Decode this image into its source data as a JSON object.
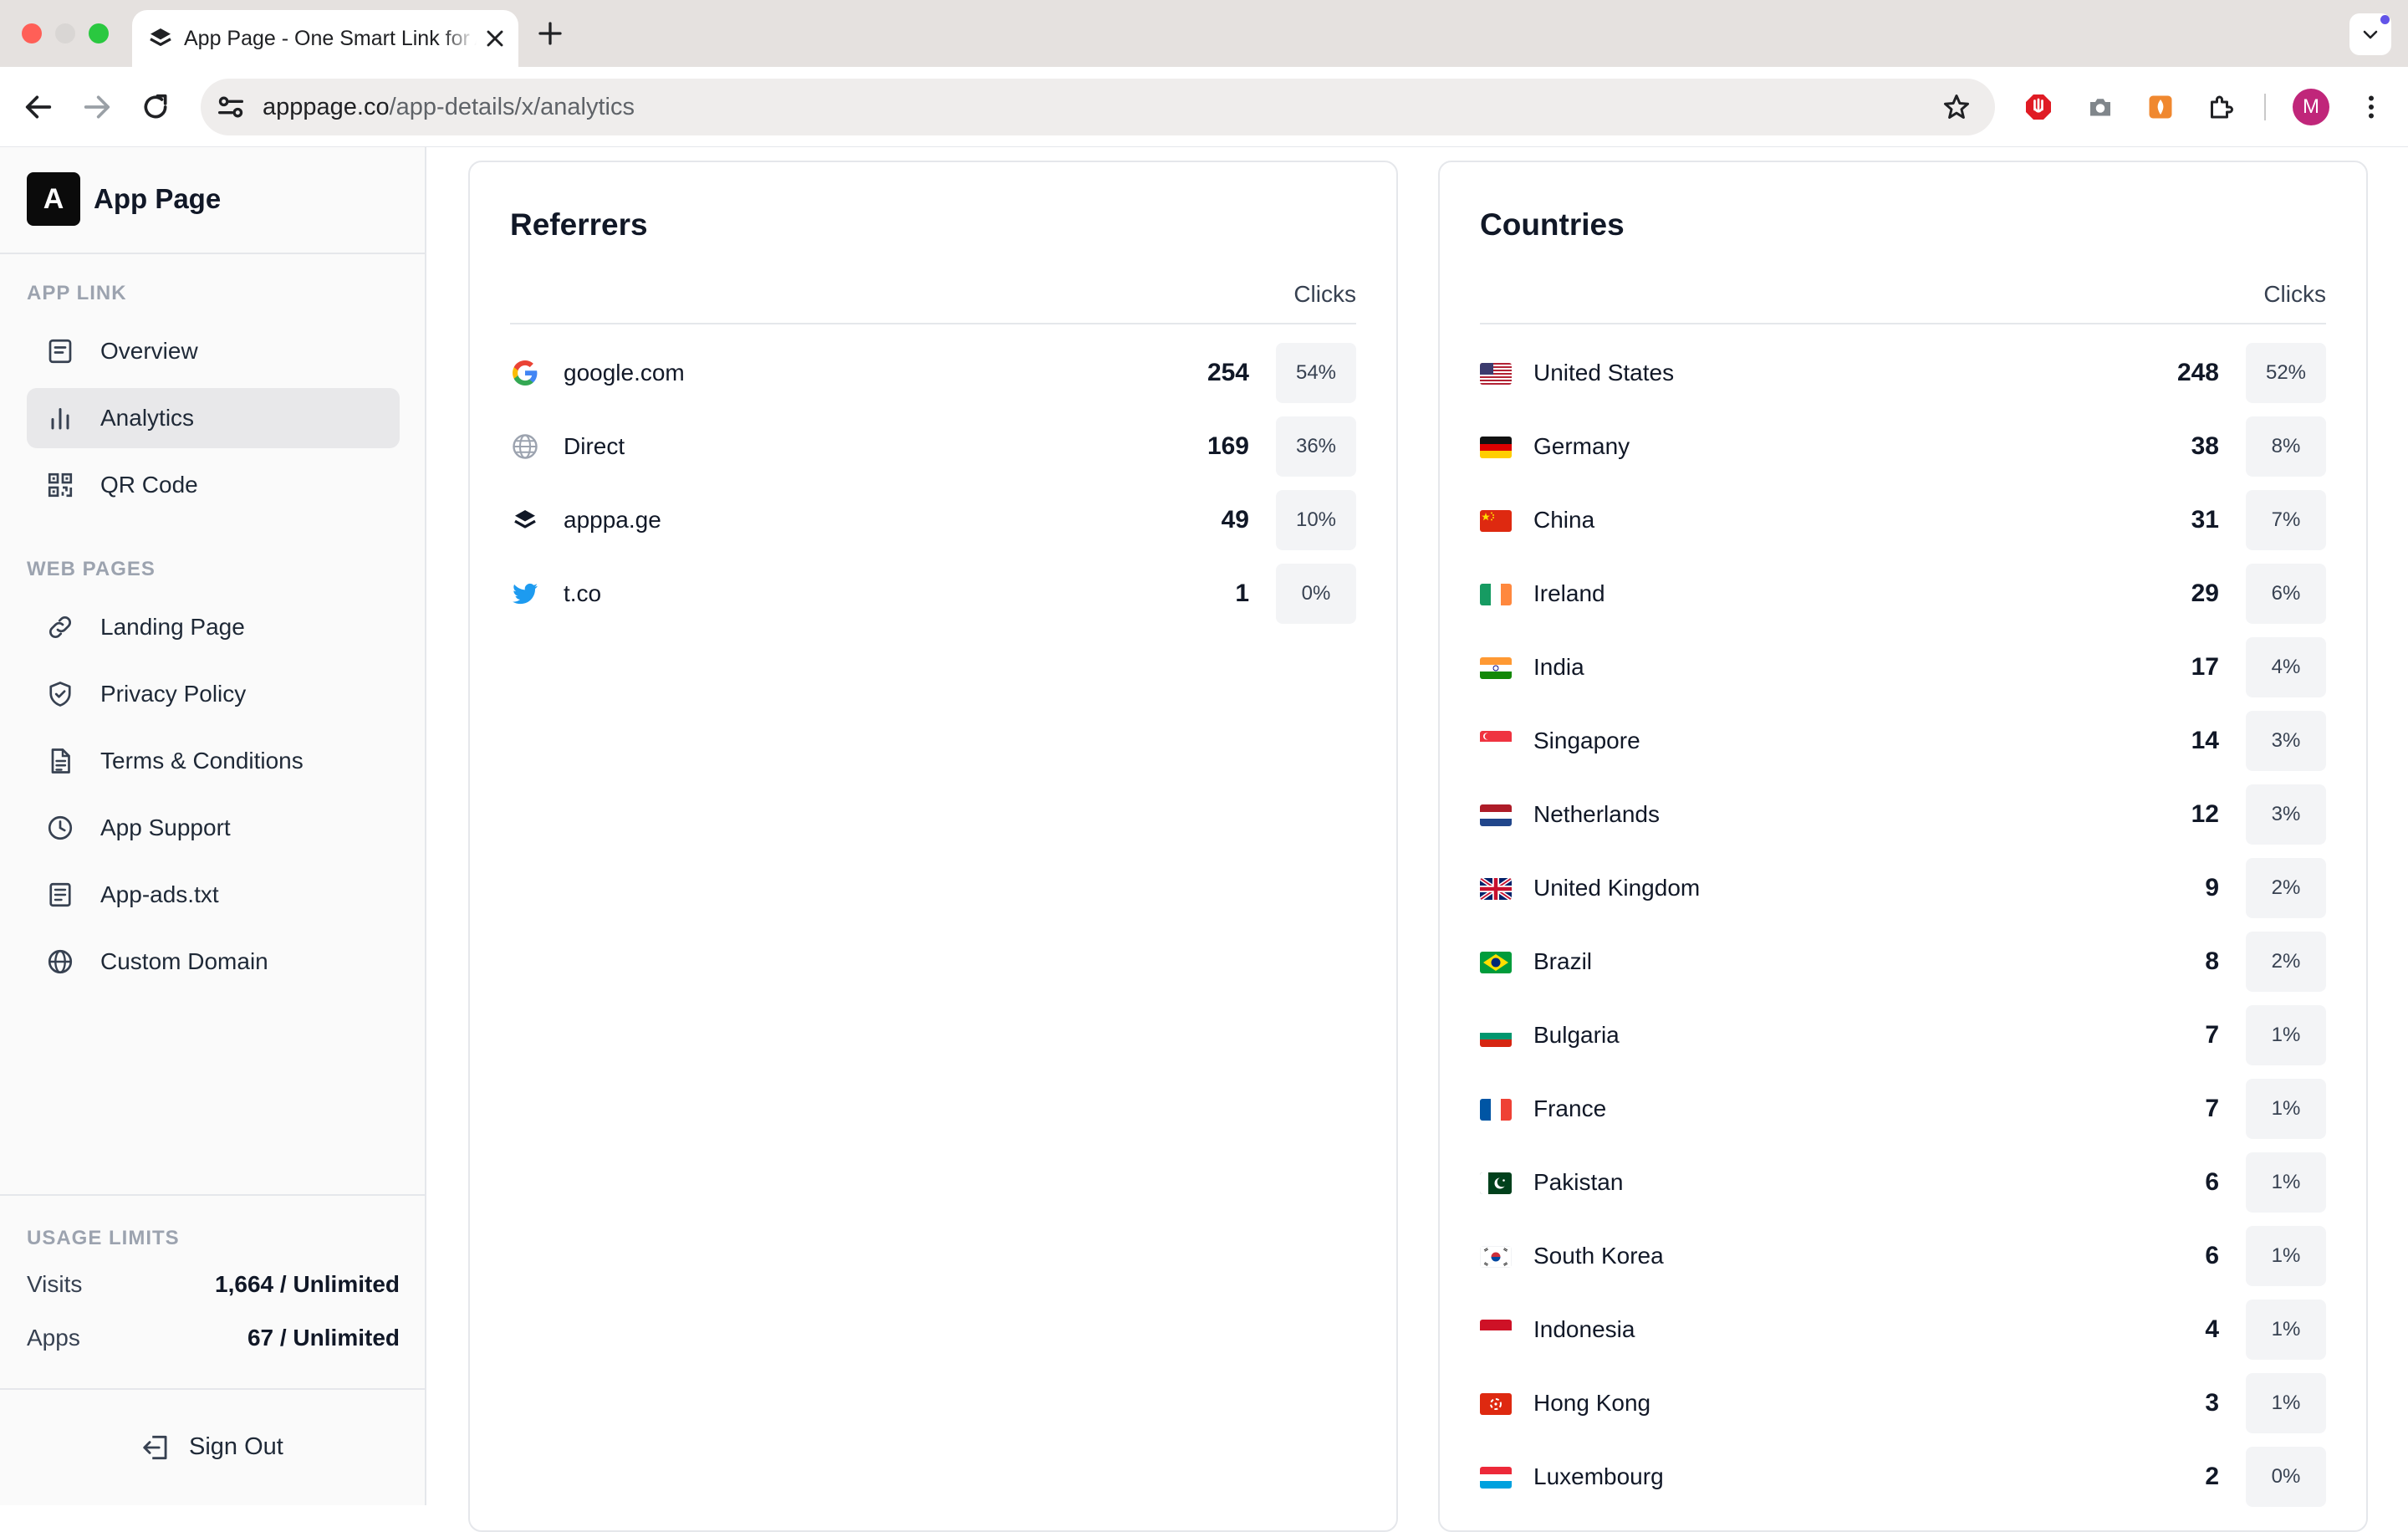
{
  "browser": {
    "tab_title": "App Page - One Smart Link for Apps",
    "url_host": "apppage.co",
    "url_path": "/app-details/x/analytics",
    "avatar_letter": "M",
    "accent_colors": {
      "close": "#ff5f57",
      "zoom": "#2ac840",
      "avatar": "#c0267a",
      "tab_search_dot": "#6254e8"
    }
  },
  "sidebar": {
    "brand": {
      "logo_letter": "A",
      "name": "App Page"
    },
    "app_link_title": "APP LINK",
    "app_link_items": [
      {
        "label": "Overview",
        "icon": "overview-icon"
      },
      {
        "label": "Analytics",
        "icon": "bar-chart-icon",
        "active": true
      },
      {
        "label": "QR Code",
        "icon": "qr-code-icon"
      }
    ],
    "web_pages_title": "WEB PAGES",
    "web_pages_items": [
      {
        "label": "Landing Page",
        "icon": "link-icon"
      },
      {
        "label": "Privacy Policy",
        "icon": "shield-icon"
      },
      {
        "label": "Terms & Conditions",
        "icon": "document-icon"
      },
      {
        "label": "App Support",
        "icon": "clock-icon"
      },
      {
        "label": "App-ads.txt",
        "icon": "text-file-icon"
      },
      {
        "label": "Custom Domain",
        "icon": "globe-icon"
      }
    ],
    "usage": {
      "title": "USAGE LIMITS",
      "visits_label": "Visits",
      "visits_value": "1,664 / Unlimited",
      "apps_label": "Apps",
      "apps_value": "67 / Unlimited"
    },
    "sign_out_label": "Sign Out"
  },
  "referrers": {
    "title": "Referrers",
    "column": "Clicks",
    "rows": [
      {
        "icon": "google-icon",
        "name": "google.com",
        "clicks": "254",
        "pct": "54%"
      },
      {
        "icon": "globe-icon",
        "name": "Direct",
        "clicks": "169",
        "pct": "36%"
      },
      {
        "icon": "apppage-logo-icon",
        "name": "apppa.ge",
        "clicks": "49",
        "pct": "10%"
      },
      {
        "icon": "twitter-icon",
        "name": "t.co",
        "clicks": "1",
        "pct": "0%"
      }
    ]
  },
  "countries": {
    "title": "Countries",
    "column": "Clicks",
    "rows": [
      {
        "flag": "us",
        "name": "United States",
        "clicks": "248",
        "pct": "52%"
      },
      {
        "flag": "de",
        "name": "Germany",
        "clicks": "38",
        "pct": "8%"
      },
      {
        "flag": "cn",
        "name": "China",
        "clicks": "31",
        "pct": "7%"
      },
      {
        "flag": "ie",
        "name": "Ireland",
        "clicks": "29",
        "pct": "6%"
      },
      {
        "flag": "in",
        "name": "India",
        "clicks": "17",
        "pct": "4%"
      },
      {
        "flag": "sg",
        "name": "Singapore",
        "clicks": "14",
        "pct": "3%"
      },
      {
        "flag": "nl",
        "name": "Netherlands",
        "clicks": "12",
        "pct": "3%"
      },
      {
        "flag": "gb",
        "name": "United Kingdom",
        "clicks": "9",
        "pct": "2%"
      },
      {
        "flag": "br",
        "name": "Brazil",
        "clicks": "8",
        "pct": "2%"
      },
      {
        "flag": "bg",
        "name": "Bulgaria",
        "clicks": "7",
        "pct": "1%"
      },
      {
        "flag": "fr",
        "name": "France",
        "clicks": "7",
        "pct": "1%"
      },
      {
        "flag": "pk",
        "name": "Pakistan",
        "clicks": "6",
        "pct": "1%"
      },
      {
        "flag": "kr",
        "name": "South Korea",
        "clicks": "6",
        "pct": "1%"
      },
      {
        "flag": "id",
        "name": "Indonesia",
        "clicks": "4",
        "pct": "1%"
      },
      {
        "flag": "hk",
        "name": "Hong Kong",
        "clicks": "3",
        "pct": "1%"
      },
      {
        "flag": "lu",
        "name": "Luxembourg",
        "clicks": "2",
        "pct": "0%"
      }
    ]
  }
}
